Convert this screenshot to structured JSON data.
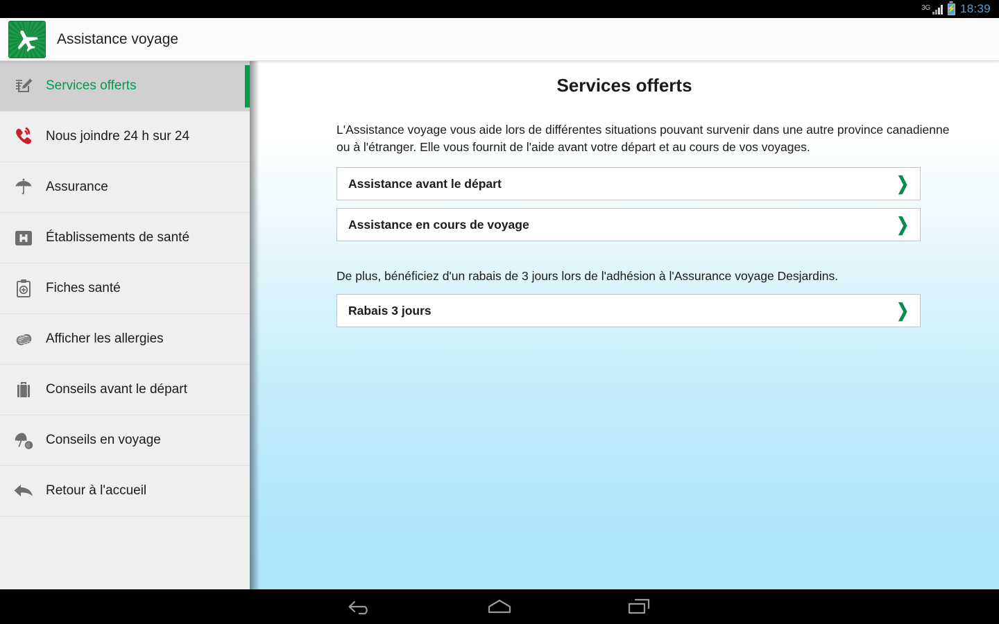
{
  "status_bar": {
    "network": "3G",
    "battery_icon": "battery-charging-icon",
    "signal_icon": "signal-bars-icon",
    "time": "18:39"
  },
  "app_bar": {
    "icon": "airplane-app-icon",
    "title": "Assistance voyage"
  },
  "sidebar": {
    "items": [
      {
        "label": "Services offerts",
        "icon": "document-pencil-icon",
        "selected": true
      },
      {
        "label": "Nous joindre 24 h sur 24",
        "icon": "phone-ringing-icon",
        "selected": false
      },
      {
        "label": "Assurance",
        "icon": "umbrella-icon",
        "selected": false
      },
      {
        "label": "Établissements de santé",
        "icon": "hospital-icon",
        "selected": false
      },
      {
        "label": "Fiches santé",
        "icon": "clipboard-plus-icon",
        "selected": false
      },
      {
        "label": "Afficher les allergies",
        "icon": "peanut-icon",
        "selected": false
      },
      {
        "label": "Conseils avant le départ",
        "icon": "suitcase-icon",
        "selected": false
      },
      {
        "label": "Conseils en voyage",
        "icon": "beach-umbrella-icon",
        "selected": false
      },
      {
        "label": "Retour à l'accueil",
        "icon": "back-arrow-icon",
        "selected": false
      }
    ]
  },
  "main": {
    "title": "Services offerts",
    "intro": "L'Assistance voyage vous aide lors de différentes situations pouvant survenir dans une autre province canadienne ou à l'étranger. Elle vous fournit de l'aide avant votre départ et au cours de vos voyages.",
    "cards": [
      {
        "label": "Assistance avant le départ",
        "chevron": "chevron-right-icon"
      },
      {
        "label": "Assistance en cours de voyage",
        "chevron": "chevron-right-icon"
      }
    ],
    "promo_text": "De plus, bénéficiez d'un rabais de 3 jours lors de l'adhésion à l'Assurance voyage Desjardins.",
    "promo_cards": [
      {
        "label": "Rabais 3 jours",
        "chevron": "chevron-right-icon"
      }
    ]
  },
  "nav_bar": {
    "back": "back-nav-icon",
    "home": "home-nav-icon",
    "recents": "recents-nav-icon"
  },
  "colors": {
    "brand_green": "#009b4d",
    "chevron_green": "#0e8a4f",
    "phone_red": "#c8202a",
    "status_time_blue": "#4ba3d3",
    "sidebar_bg": "#efefef",
    "sidebar_selected_bg": "#d0d0d0",
    "content_gradient_bottom": "#ade5f9"
  }
}
